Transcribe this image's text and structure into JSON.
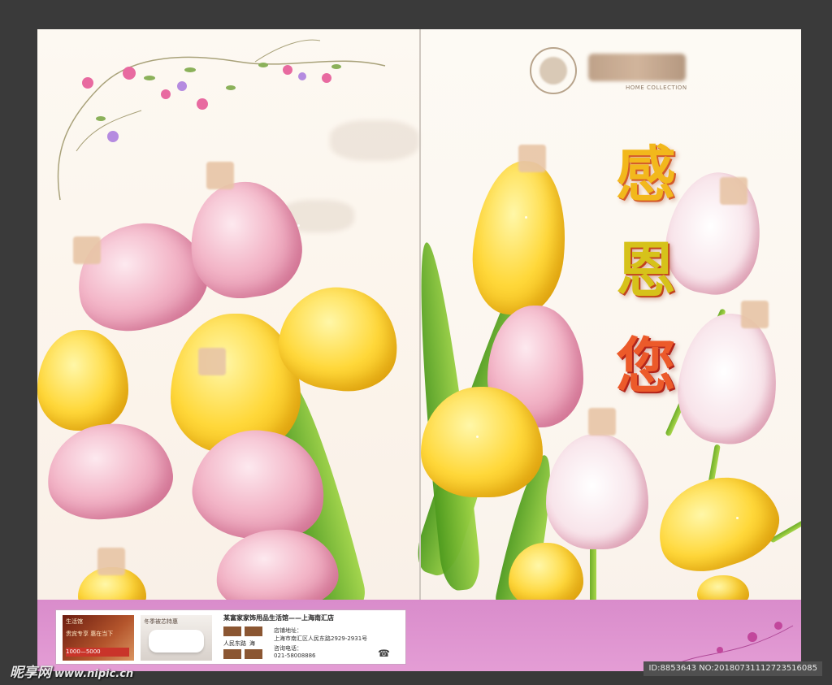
{
  "card": {
    "title_chars": [
      "感",
      "恩",
      "您"
    ]
  },
  "logo": {
    "subtitle": "HOME COLLECTION"
  },
  "info": {
    "title": "某富家家饰用品生活馆——上海南汇店",
    "thumb1_tag": "生活馆",
    "thumb1_text": "贵宾专享 惠在当下",
    "thumb1_price": "1000—5000",
    "thumb2_tag": "冬季被芯特惠",
    "address_label": "店铺地址：",
    "address": "上海市南汇区人民东路2929-2931号",
    "phone_label": "咨询电话：",
    "phone": "021-58008886",
    "swatch_label_1": "人民东路",
    "swatch_label_2": "海"
  },
  "watermark": {
    "brand": "昵享网",
    "url": "www.nipic.cn",
    "id_text": "ID:8853643 NO:20180731112723516085"
  },
  "colors": {
    "band": "#e49dd5",
    "title_gold": "#f2b81c",
    "title_red": "#ec5a2a"
  }
}
